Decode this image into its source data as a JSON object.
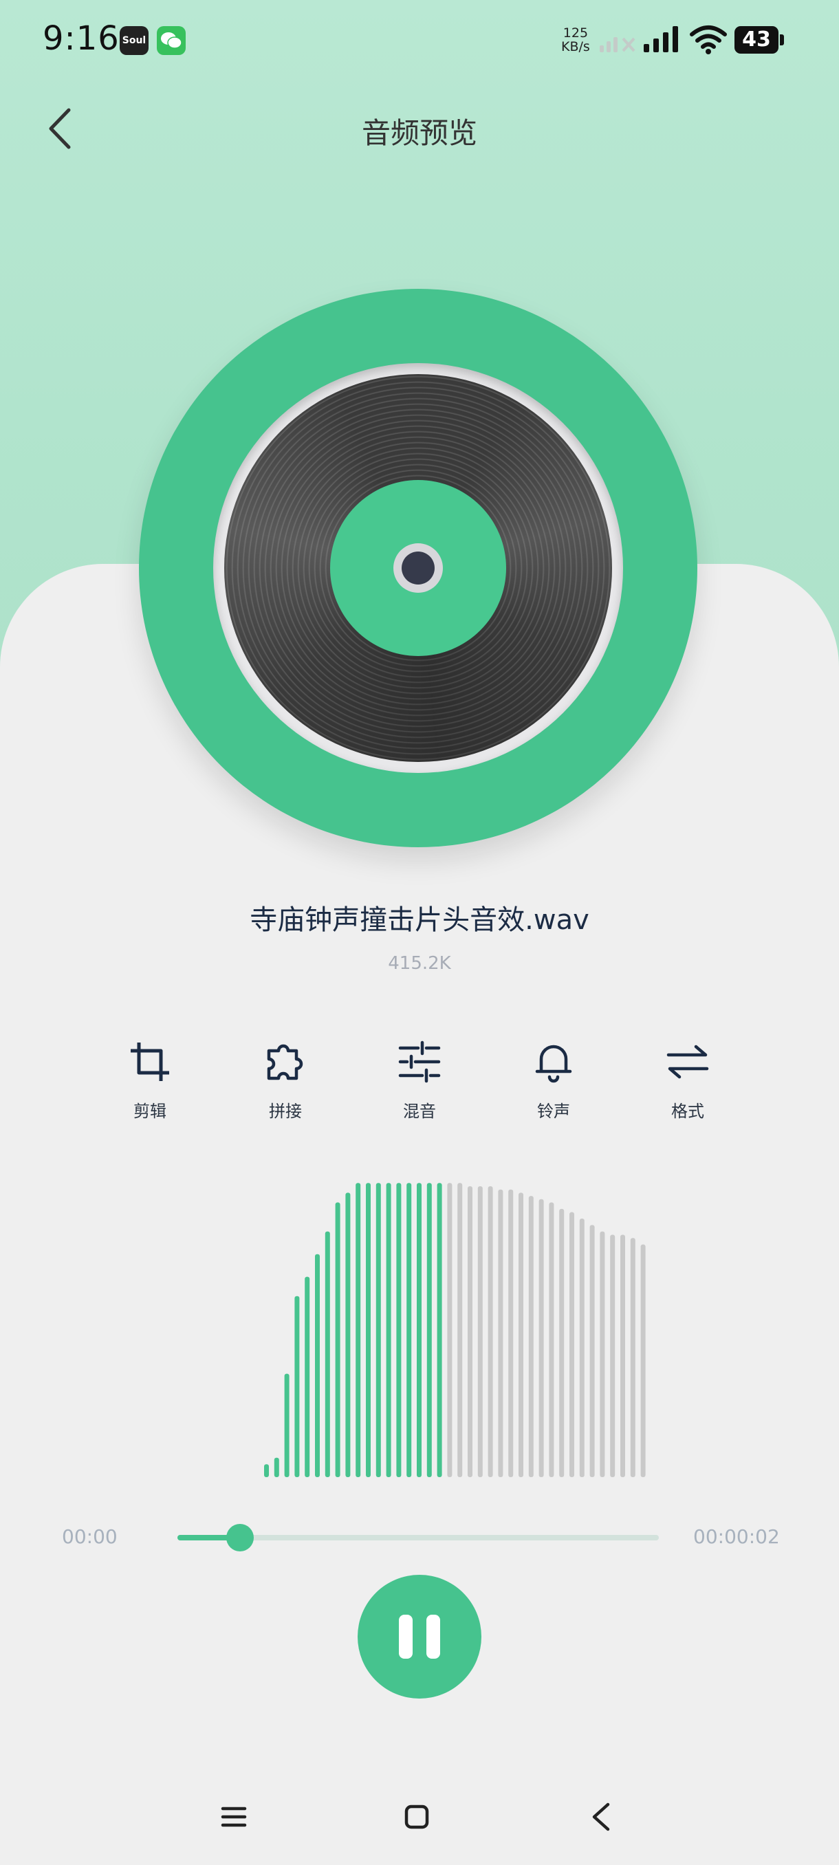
{
  "status_bar": {
    "time": "9:16",
    "soul_label": "Soul",
    "net_speed_value": "125",
    "net_speed_unit": "KB/s",
    "battery": "43"
  },
  "header": {
    "title": "音频预览"
  },
  "file": {
    "name": "寺庙钟声撞击片头音效.wav",
    "size": "415.2K"
  },
  "tools": [
    {
      "label": "剪辑",
      "icon": "crop-icon"
    },
    {
      "label": "拼接",
      "icon": "puzzle-icon"
    },
    {
      "label": "混音",
      "icon": "sliders-icon"
    },
    {
      "label": "铃声",
      "icon": "bell-icon"
    },
    {
      "label": "格式",
      "icon": "swap-arrows-icon"
    }
  ],
  "waveform": {
    "levels": [
      0.04,
      0.06,
      0.32,
      0.56,
      0.62,
      0.69,
      0.76,
      0.85,
      0.88,
      0.91,
      0.91,
      0.91,
      0.91,
      0.91,
      0.91,
      0.91,
      0.91,
      0.91,
      0.91,
      0.91,
      0.9,
      0.9,
      0.9,
      0.89,
      0.89,
      0.88,
      0.87,
      0.86,
      0.85,
      0.83,
      0.82,
      0.8,
      0.78,
      0.76,
      0.75,
      0.75,
      0.74,
      0.72
    ],
    "played_bars": 18,
    "played_color": "#46c38e",
    "unplayed_color": "#c9c9c9"
  },
  "playback": {
    "current_time": "00:00",
    "total_time": "00:00:02",
    "progress": 0.13,
    "state": "playing",
    "accent": "#46c38e"
  }
}
